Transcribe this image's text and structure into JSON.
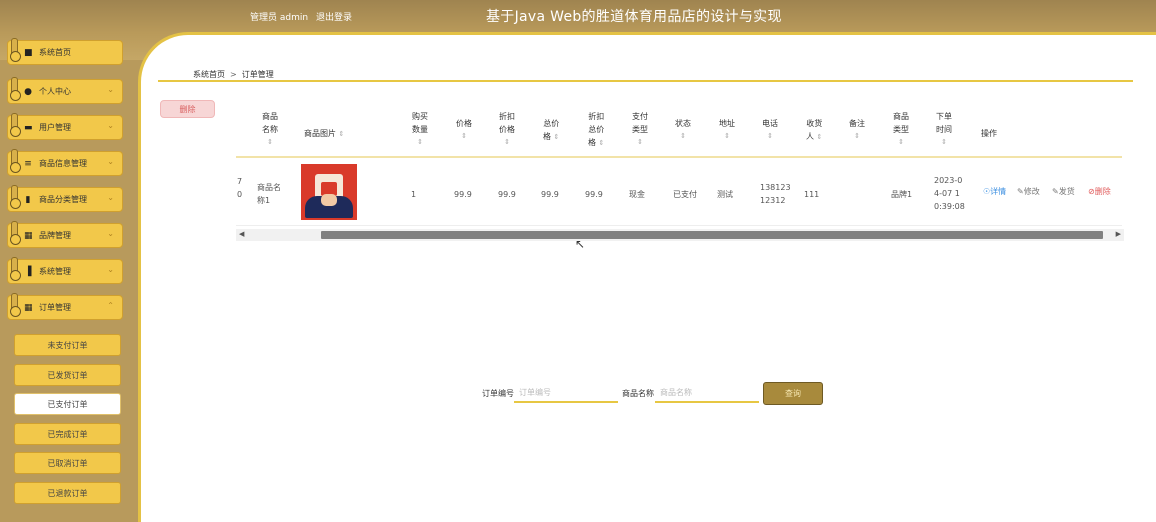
{
  "header": {
    "role_label": "管理员 admin",
    "logout_label": "退出登录",
    "title": "基于Java Web的胜道体育用品店的设计与实现"
  },
  "sidebar": {
    "items": [
      {
        "label": "系统首页",
        "icon": "home-icon"
      },
      {
        "label": "个人中心",
        "icon": "person-icon"
      },
      {
        "label": "用户管理",
        "icon": "user-card-icon"
      },
      {
        "label": "商品信息管理",
        "icon": "list-icon"
      },
      {
        "label": "商品分类管理",
        "icon": "comment-icon"
      },
      {
        "label": "品牌管理",
        "icon": "grid-icon"
      },
      {
        "label": "系统管理",
        "icon": "bar-chart-icon"
      },
      {
        "label": "订单管理",
        "icon": "grid-icon"
      }
    ],
    "sub_items": [
      {
        "label": "未支付订单"
      },
      {
        "label": "已发货订单"
      },
      {
        "label": "已支付订单"
      },
      {
        "label": "已完成订单"
      },
      {
        "label": "已取消订单"
      },
      {
        "label": "已退款订单"
      }
    ]
  },
  "breadcrumb": {
    "home": "系统首页",
    "sep": ">",
    "current": "订单管理"
  },
  "toolbar": {
    "delete_label": "删除"
  },
  "table": {
    "headers": {
      "product_name": [
        "商品",
        "名称"
      ],
      "product_image": "商品图片",
      "quantity": [
        "购买",
        "数量"
      ],
      "price": "价格",
      "discount_price": [
        "折扣",
        "价格"
      ],
      "total_price": [
        "总价",
        "格"
      ],
      "discount_total": [
        "折扣",
        "总价",
        "格"
      ],
      "pay_type": [
        "支付",
        "类型"
      ],
      "status": "状态",
      "address": "地址",
      "phone": "电话",
      "receiver": [
        "收货",
        "人"
      ],
      "remark": "备注",
      "product_type": [
        "商品",
        "类型"
      ],
      "order_time": [
        "下单",
        "时间"
      ],
      "actions": "操作"
    },
    "sort_icon": "sort-icon",
    "rows": [
      {
        "order_no": [
          "7",
          "0"
        ],
        "product_name": [
          "商品名",
          "称1"
        ],
        "quantity": "1",
        "price": "99.9",
        "discount_price": "99.9",
        "total_price": "99.9",
        "discount_total": "99.9",
        "pay_type": "现金",
        "status": "已支付",
        "address": "测试",
        "phone": [
          "138123",
          "12312"
        ],
        "receiver": "111",
        "remark": "",
        "product_type": "品牌1",
        "order_time": [
          "2023-0",
          "4-07 1",
          "0:39:08"
        ],
        "actions": {
          "detail": "详情",
          "edit": "修改",
          "ship": "发货",
          "delete": "删除"
        }
      }
    ]
  },
  "search": {
    "order_no_label": "订单编号",
    "order_no_placeholder": "订单编号",
    "product_name_label": "商品名称",
    "product_name_placeholder": "商品名称",
    "button_label": "查询"
  },
  "colors": {
    "accent": "#e7c743",
    "menu": "#f2c84a",
    "header": "#b99a5a",
    "delete": "#e05a5a",
    "link": "#3a8ee0"
  }
}
